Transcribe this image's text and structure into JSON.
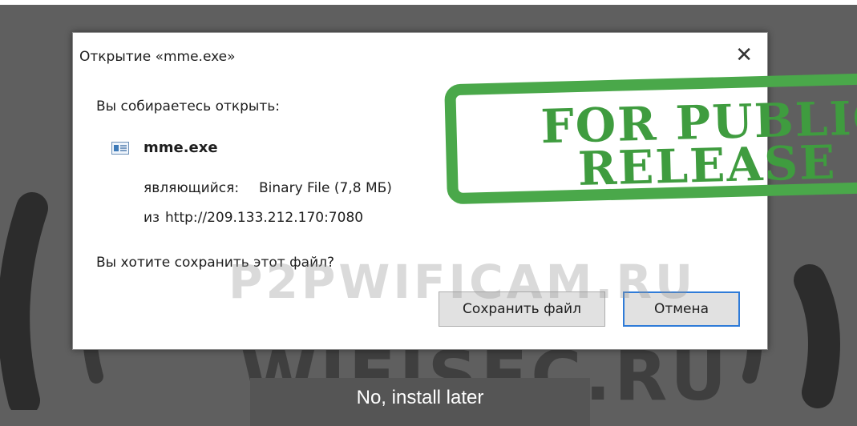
{
  "dialog": {
    "title": "Открытие «mme.exe»",
    "close": "✕",
    "prompt": "Вы собираетесь открыть:",
    "file_icon": "file-window-icon",
    "file_name": "mme.exe",
    "type_label": "являющийся:",
    "type_value": "Binary File (7,8 МБ)",
    "from_label": "из",
    "from_value": "http://209.133.212.170:7080",
    "question": "Вы хотите сохранить этот файл?",
    "save_button": "Сохранить файл",
    "cancel_button": "Отмена"
  },
  "stamp": {
    "line1": "FOR PUBLIC",
    "line2": "RELEASE",
    "color": "#3f9c3f"
  },
  "watermark": {
    "top": "P2PWIFICAM.RU",
    "bottom": "WIFISEC.RU"
  },
  "background_button": {
    "label": "No, install later"
  },
  "colors": {
    "accent_border": "#2f7bd8",
    "backdrop": "#5f5f5f"
  }
}
